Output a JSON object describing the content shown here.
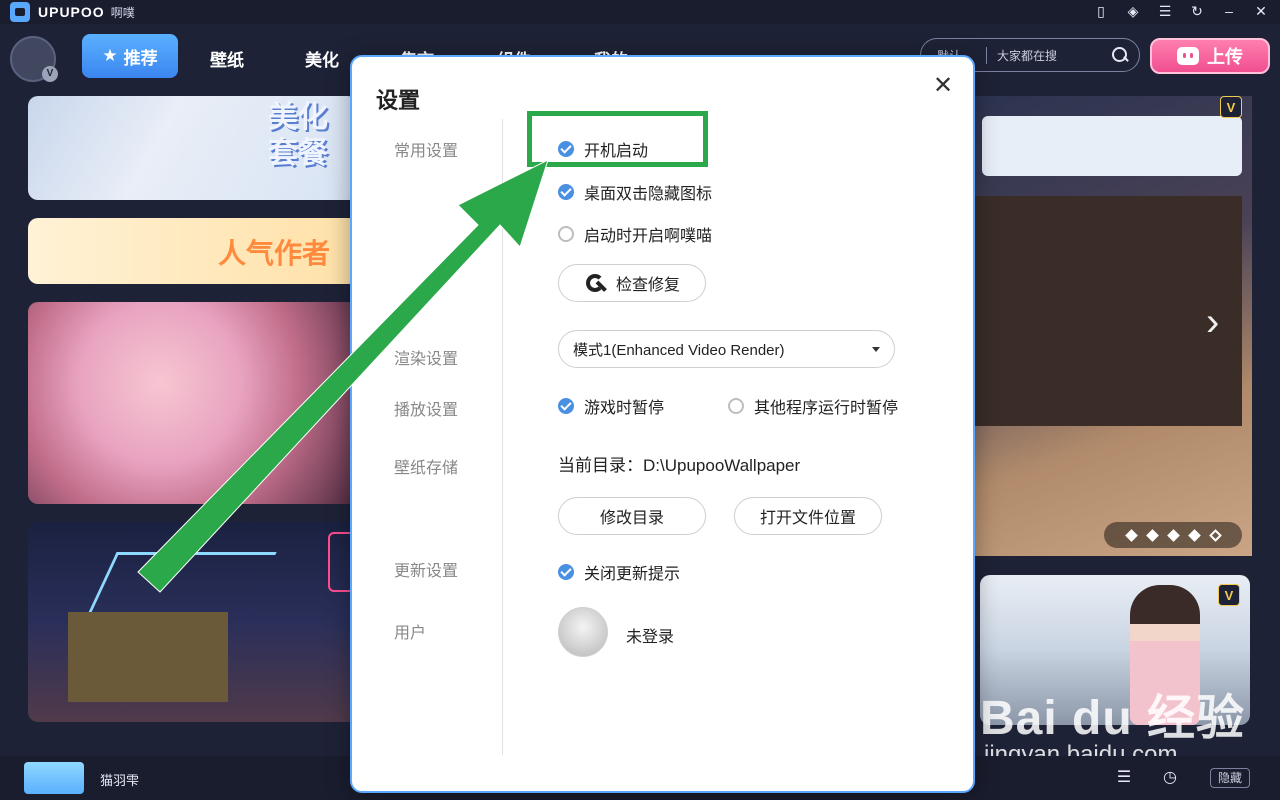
{
  "titlebar": {
    "app_name": "UPUPOO",
    "app_sub": "啊噗",
    "window_buttons": [
      "phone-icon",
      "diamond-icon",
      "menu-icon",
      "refresh-icon",
      "minimize-icon",
      "close-icon"
    ]
  },
  "nav": {
    "active": "推荐",
    "items": [
      "壁纸",
      "美化",
      "集市",
      "组件",
      "我的"
    ],
    "search_type": "默认",
    "search_placeholder": "大家都在搜",
    "upload_label": "上传"
  },
  "cards": {
    "card1_text": "美化\n套餐",
    "card2_text": "人气作者"
  },
  "right": {
    "badge": "V",
    "watermark": "Bai du 经验",
    "watermark_sub": "jingyan.baidu.com"
  },
  "bottom": {
    "wallpaper_name": "猫羽雫",
    "hide_label": "隐藏"
  },
  "dialog": {
    "title": "设置",
    "sections": {
      "general": "常用设置",
      "render": "渲染设置",
      "playback": "播放设置",
      "storage": "壁纸存储",
      "update": "更新设置",
      "user": "用户"
    },
    "options": {
      "autostart": {
        "label": "开机启动",
        "checked": true
      },
      "double_click_hide": {
        "label": "桌面双击隐藏图标",
        "checked": true
      },
      "open_on_start": {
        "label": "启动时开启啊噗喵",
        "checked": false
      },
      "pause_game": {
        "label": "游戏时暂停",
        "checked": true
      },
      "pause_other": {
        "label": "其他程序运行时暂停",
        "checked": false
      },
      "close_update": {
        "label": "关闭更新提示",
        "checked": true
      }
    },
    "check_repair_label": "检查修复",
    "render_mode": "模式1(Enhanced Video Render)",
    "current_dir_label": "当前目录：",
    "current_dir": "D:\\UpupooWallpaper",
    "change_dir_label": "修改目录",
    "open_location_label": "打开文件位置",
    "user_status": "未登录"
  },
  "colors": {
    "accent": "#4a90e2",
    "highlight": "#2aa84a",
    "upload": "#f04f8f"
  }
}
